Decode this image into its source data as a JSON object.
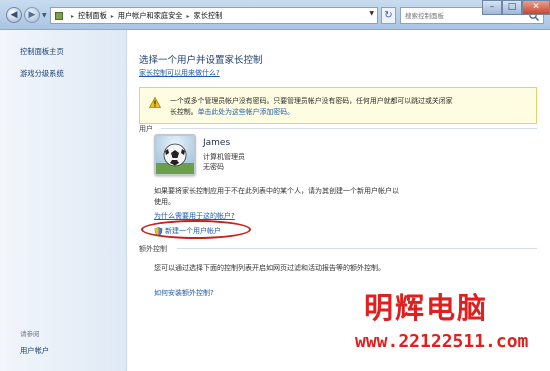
{
  "window": {
    "buttons": {
      "minimize": "–",
      "maximize": "□",
      "close": "✕"
    }
  },
  "toolbar": {
    "breadcrumbs": [
      "控制面板",
      "用户帐户和家庭安全",
      "家长控制"
    ],
    "search_placeholder": "搜索控制面板",
    "refresh_icon": "refresh-icon"
  },
  "sidebar": {
    "items": [
      {
        "label": "控制面板主页"
      },
      {
        "label": "游戏分级系统"
      }
    ],
    "see_also_label": "请参阅",
    "see_also_items": [
      {
        "label": "用户帐户"
      }
    ]
  },
  "main": {
    "title": "选择一个用户并设置家长控制",
    "help_link": "家长控制可以用来做什么?",
    "warning": {
      "text_line1": "一个或多个管理员帐户没有密码。只要管理员帐户没有密码，任何用户就都可以跳过或关闭家",
      "text_line2_plain": "长控制。",
      "text_line2_link": "单击此处为这些帐户添加密码。"
    },
    "users_label": "用户",
    "user": {
      "name": "James",
      "role": "计算机管理员",
      "password_status": "无密码"
    },
    "info_text": "如果要将家长控制应用于不在此列表中的某个人，请为其创建一个新用户帐户以使用。",
    "why_link": "为什么需要用于这的帐户?",
    "new_user_link": "新建一个用户帐户",
    "extra_label": "额外控制",
    "extra_text": "您可以通过选择下面的控制列表开启如网页过滤和活动报告等的额外控制。",
    "install_link": "如何安装额外控制?"
  },
  "watermark": {
    "brand": "明辉电脑",
    "url": "www.22122511.com"
  },
  "colors": {
    "link": "#1f5aa8",
    "title": "#1f3f72",
    "warning_bg": "#fffde1",
    "annotation_red": "#c8201a"
  }
}
